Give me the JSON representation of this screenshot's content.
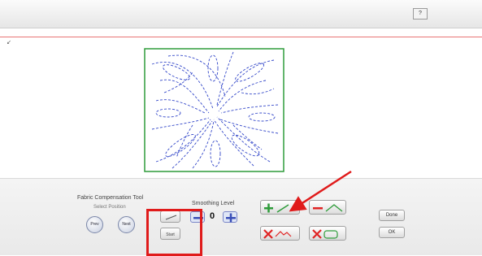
{
  "toolbar": {
    "help_label": "?"
  },
  "canvas": {
    "cursor_mark": "↙"
  },
  "panel": {
    "title": "Fabric Compensation Tool",
    "subtitle": "Select Position",
    "prev_label": "Prev",
    "next_label": "Next",
    "smoothing_label": "Smoothing Level",
    "smoothing_value": "0",
    "small_btn_top_label": "",
    "small_btn_bottom_label": "Start",
    "done_label": "Done",
    "cancel_label": "OK"
  },
  "colors": {
    "accent_green": "#2e9c3a",
    "accent_red": "#e02424",
    "stitch_blue": "#3347c9",
    "arrow_red": "#e01b1b"
  },
  "icons": [
    "help-icon",
    "add-point-icon",
    "remove-point-icon",
    "delete-segment-icon",
    "delete-shape-icon",
    "arrow-annotation",
    "plus-icon",
    "minus-icon"
  ]
}
